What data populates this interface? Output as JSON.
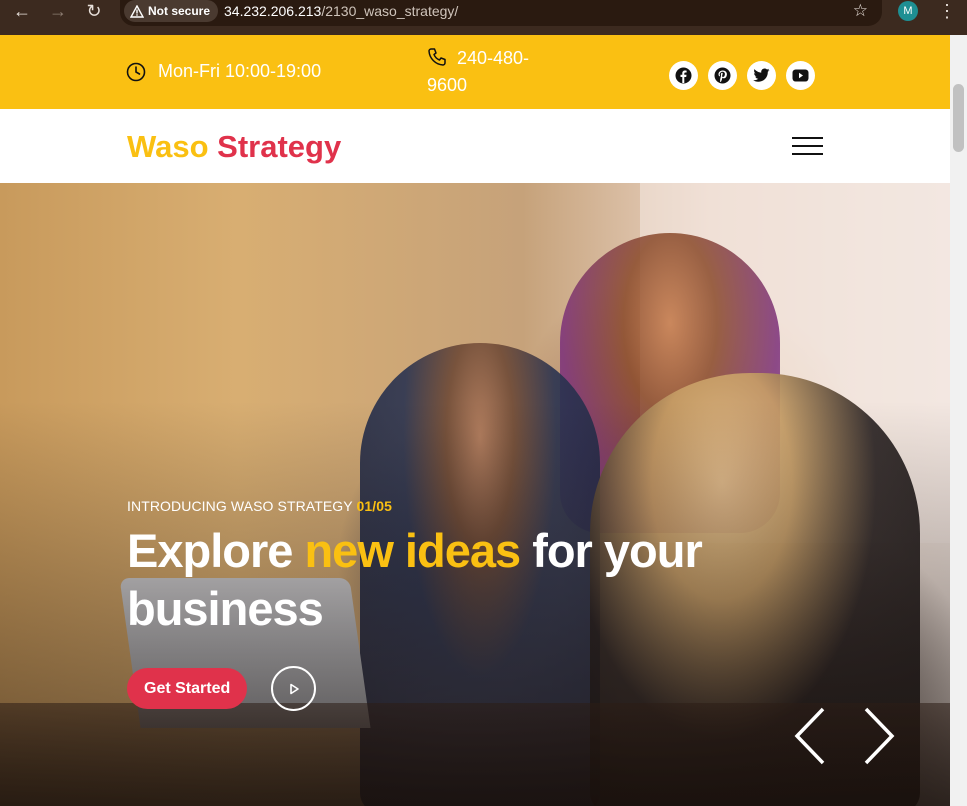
{
  "browser": {
    "security_label": "Not secure",
    "url_host": "34.232.206.213",
    "url_path": "/2130_waso_strategy/",
    "profile_initial": "M"
  },
  "topbar": {
    "hours": "Mon-Fri 10:00-19:00",
    "phone": "240-480-9600",
    "socials": [
      "facebook-icon",
      "pinterest-icon",
      "twitter-icon",
      "youtube-icon"
    ],
    "background": "#fac012"
  },
  "header": {
    "logo_part1": "Waso",
    "logo_part2": "Strategy",
    "logo_colors": [
      "#fac012",
      "#e0324b"
    ]
  },
  "hero": {
    "eyebrow": "INTRODUCING WASO STRATEGY",
    "slide_counter": "01/05",
    "title_start": "Explore",
    "title_accent": "new ideas",
    "title_end": "for your business",
    "cta_label": "Get Started",
    "accent_color": "#fac012",
    "cta_color": "#e0324b"
  }
}
